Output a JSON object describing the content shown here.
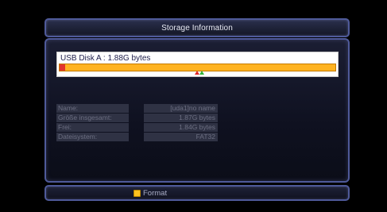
{
  "title": "Storage Information",
  "disk": {
    "label": "USB Disk A : 1.88G bytes",
    "used_fraction": 0.02,
    "bar_color": "#ffb321",
    "used_color": "#e2352e"
  },
  "info_rows": [
    {
      "label": "Name:",
      "value": "[uda1]no name"
    },
    {
      "label": "Größe insgesamt:",
      "value": "1.87G bytes"
    },
    {
      "label": "Frei:",
      "value": "1.84G bytes"
    },
    {
      "label": "Dateisystem:",
      "value": "FAT32"
    }
  ],
  "footer": {
    "format_label": "Format",
    "format_key_color": "#ffc21f",
    "format_key_icon": "yellow-key-icon"
  }
}
